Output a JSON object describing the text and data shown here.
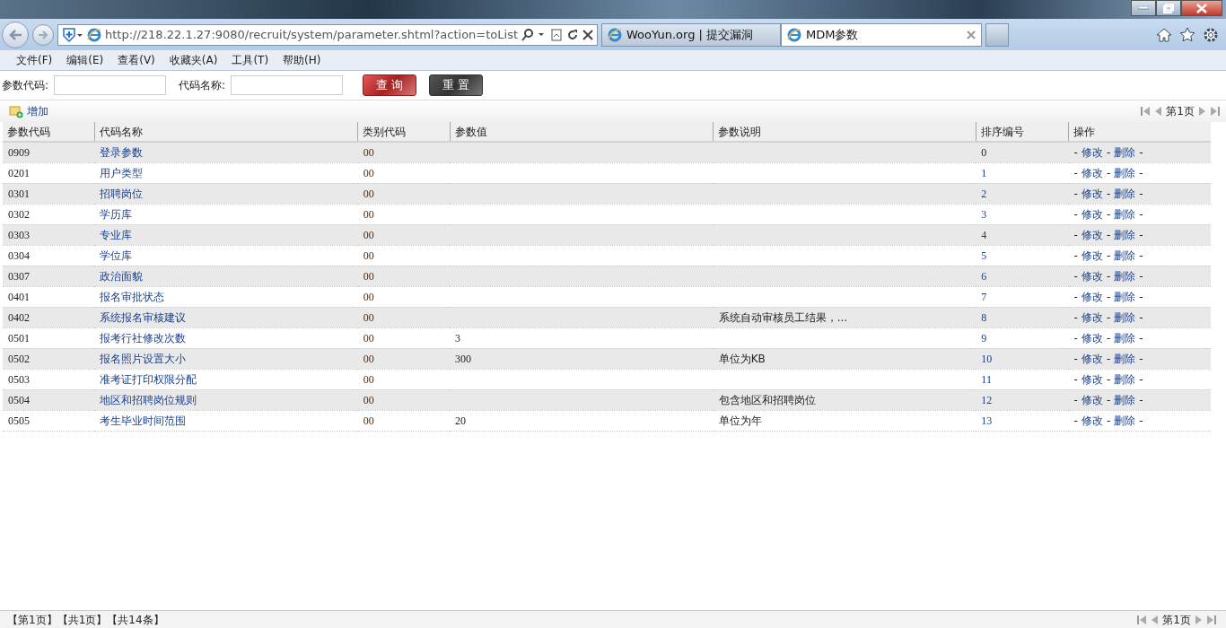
{
  "browser": {
    "address": "http://218.22.1.27:9080/recruit/system/parameter.shtml?action=toList",
    "tabs": [
      {
        "label": "WooYun.org | 提交漏洞",
        "selected": false
      },
      {
        "label": "MDM参数",
        "selected": true
      }
    ],
    "menu": [
      "文件(F)",
      "编辑(E)",
      "查看(V)",
      "收藏夹(A)",
      "工具(T)",
      "帮助(H)"
    ]
  },
  "search": {
    "fields": [
      {
        "label": "参数代码:"
      },
      {
        "label": "代码名称:"
      }
    ],
    "query_button": "查 询",
    "reset_button": "重 置"
  },
  "toolbar": {
    "add": "增加",
    "page": "第1页"
  },
  "table": {
    "columns": [
      "参数代码",
      "代码名称",
      "类别代码",
      "参数值",
      "参数说明",
      "排序编号",
      "操作"
    ],
    "rows": [
      {
        "code": "0909",
        "name": "登录参数",
        "category": "00",
        "value": "",
        "description": "",
        "order": "0",
        "actions": [
          "修改",
          "删除"
        ],
        "separator": "-"
      },
      {
        "code": "0201",
        "name": "用户类型",
        "category": "00",
        "value": "",
        "description": "",
        "order": "1",
        "actions": [
          "修改",
          "删除"
        ],
        "separator": "-"
      },
      {
        "code": "0301",
        "name": "招聘岗位",
        "category": "00",
        "value": "",
        "description": "",
        "order": "2",
        "actions": [
          "修改",
          "删除"
        ],
        "separator": "-"
      },
      {
        "code": "0302",
        "name": "学历库",
        "category": "00",
        "value": "",
        "description": "",
        "order": "3",
        "actions": [
          "修改",
          "删除"
        ],
        "separator": "-"
      },
      {
        "code": "0303",
        "name": "专业库",
        "category": "00",
        "value": "",
        "description": "",
        "order": "4",
        "actions": [
          "修改",
          "删除"
        ],
        "separator": "-"
      },
      {
        "code": "0304",
        "name": "学位库",
        "category": "00",
        "value": "",
        "description": "",
        "order": "5",
        "actions": [
          "修改",
          "删除"
        ],
        "separator": "-"
      },
      {
        "code": "0307",
        "name": "政治面貌",
        "category": "00",
        "value": "",
        "description": "",
        "order": "6",
        "actions": [
          "修改",
          "删除"
        ],
        "separator": "-"
      },
      {
        "code": "0401",
        "name": "报名审批状态",
        "category": "00",
        "value": "",
        "description": "",
        "order": "7",
        "actions": [
          "修改",
          "删除"
        ],
        "separator": "-"
      },
      {
        "code": "0402",
        "name": "系统报名审核建议",
        "category": "00",
        "value": "",
        "description": "系统自动审核员工结果，...",
        "order": "8",
        "actions": [
          "修改",
          "删除"
        ],
        "separator": "-"
      },
      {
        "code": "0501",
        "name": "报考行社修改次数",
        "category": "00",
        "value": "3",
        "description": "",
        "order": "9",
        "actions": [
          "修改",
          "删除"
        ],
        "separator": "-"
      },
      {
        "code": "0502",
        "name": "报名照片设置大小",
        "category": "00",
        "value": "300",
        "description": "单位为KB",
        "order": "10",
        "actions": [
          "修改",
          "删除"
        ],
        "separator": "-"
      },
      {
        "code": "0503",
        "name": "准考证打印权限分配",
        "category": "00",
        "value": "",
        "description": "",
        "order": "11",
        "actions": [
          "修改",
          "删除"
        ],
        "separator": "-"
      },
      {
        "code": "0504",
        "name": "地区和招聘岗位规则",
        "category": "00",
        "value": "",
        "description": "包含地区和招聘岗位",
        "order": "12",
        "actions": [
          "修改",
          "删除"
        ],
        "separator": "-"
      },
      {
        "code": "0505",
        "name": "考生毕业时间范围",
        "category": "00",
        "value": "20",
        "description": "单位为年",
        "order": "13",
        "actions": [
          "修改",
          "删除"
        ],
        "separator": "-"
      }
    ]
  },
  "footer": {
    "summary": [
      "【第1页】",
      "【共1页】",
      "【共14条】"
    ],
    "page": "第1页"
  }
}
